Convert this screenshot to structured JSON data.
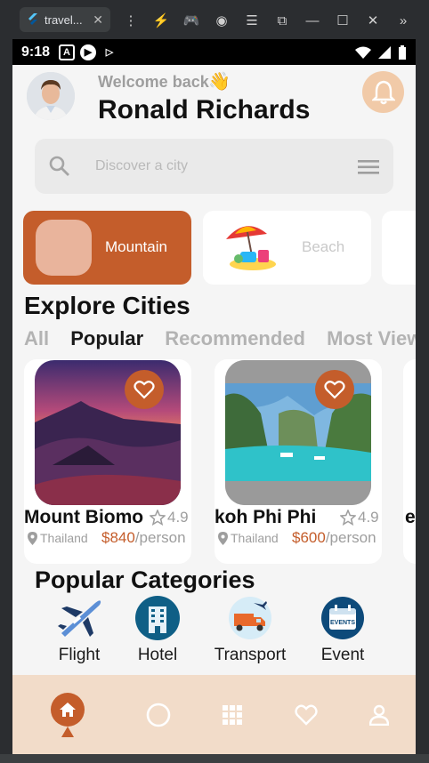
{
  "window": {
    "tab_title": "travel...",
    "tab_close": "✕"
  },
  "status_bar": {
    "time": "9:18"
  },
  "header": {
    "welcome": "Welcome back",
    "wave_icon": "👋",
    "user_name": "Ronald Richards"
  },
  "search": {
    "placeholder": "Discover a city"
  },
  "categories_top": [
    {
      "label": "Mountain",
      "active": true
    },
    {
      "label": "Beach",
      "active": false
    }
  ],
  "explore": {
    "title": "Explore Cities",
    "tabs": [
      "All",
      "Popular",
      "Recommended",
      "Most View"
    ],
    "active_tab": "Popular"
  },
  "cities": [
    {
      "name": "Mount Biomo",
      "rating": "4.9",
      "location": "Thailand",
      "price": "$840",
      "per": "/person"
    },
    {
      "name": "koh Phi Phi",
      "rating": "4.9",
      "location": "Thailand",
      "price": "$600",
      "per": "/person"
    }
  ],
  "third_card_fragment": "e",
  "popular_categories": {
    "title": "Popular Categories",
    "items": [
      {
        "label": "Flight",
        "icon": "airplane-icon"
      },
      {
        "label": "Hotel",
        "icon": "hotel-icon"
      },
      {
        "label": "Transport",
        "icon": "truck-icon"
      },
      {
        "label": "Event",
        "icon": "event-calendar-icon"
      }
    ],
    "event_badge": "EVENTS"
  },
  "bottom_nav": [
    "home-icon",
    "circle-icon",
    "grid-icon",
    "heart-icon",
    "profile-icon"
  ],
  "colors": {
    "accent": "#c45d2b",
    "accent_light": "#f2dcc9",
    "text": "#111111",
    "muted": "#9e9e9e"
  }
}
